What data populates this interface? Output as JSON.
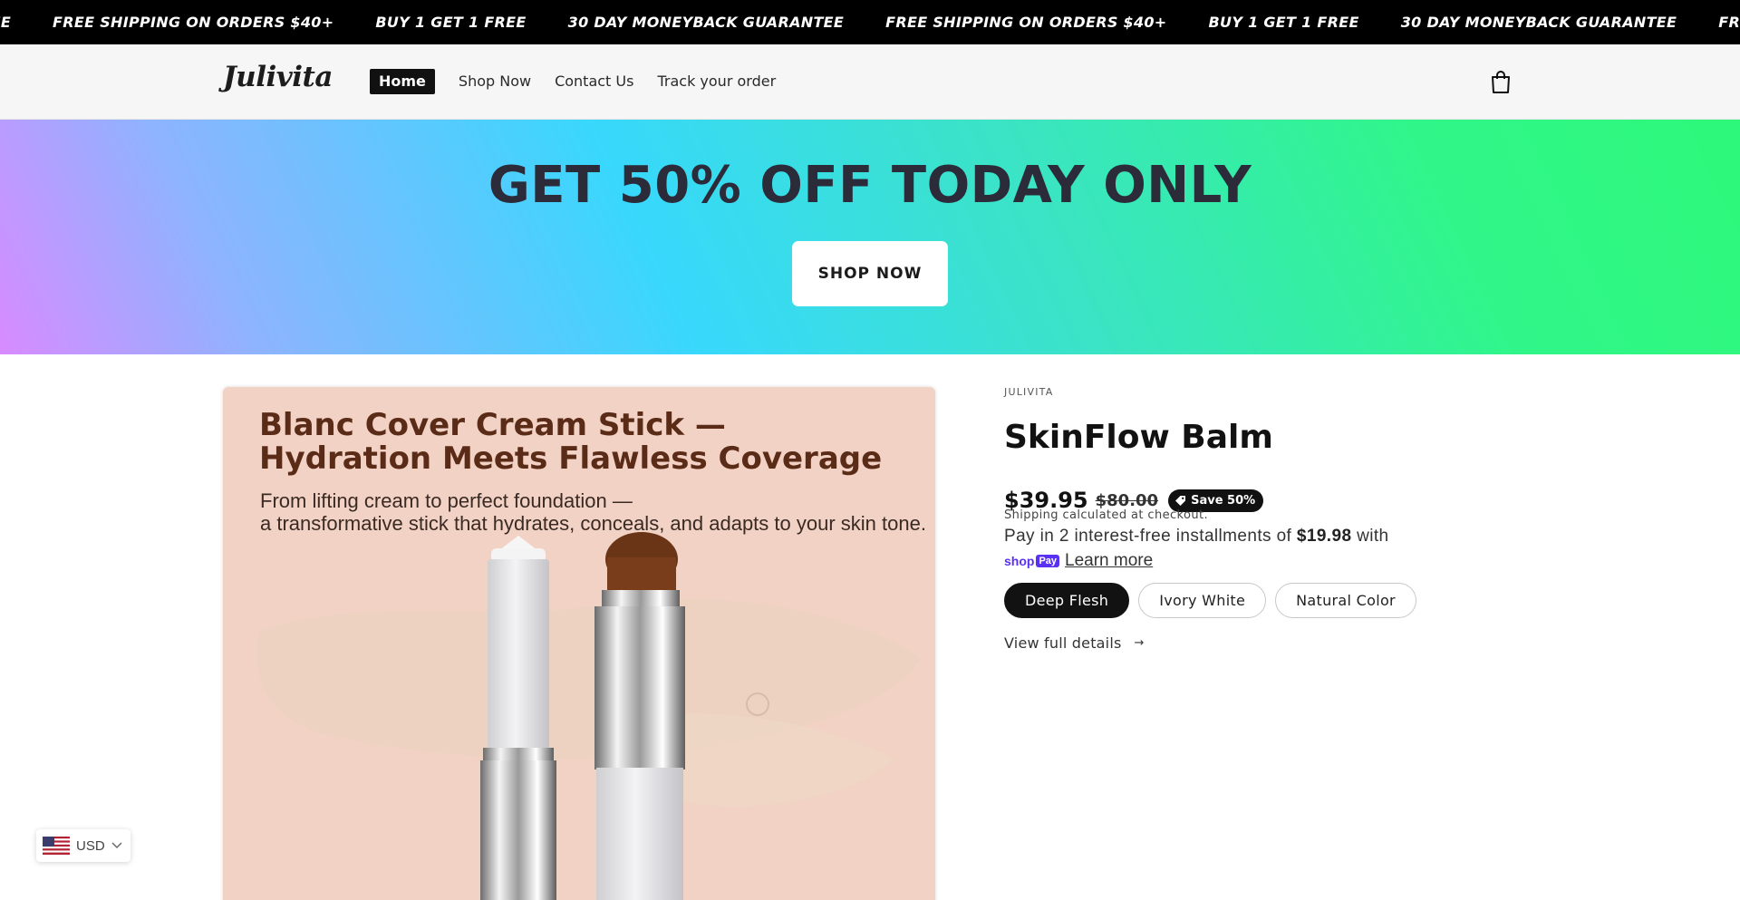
{
  "announcement": {
    "items": [
      "ANTEE",
      "FREE SHIPPING ON ORDERS $40+",
      "BUY 1 GET 1 FREE",
      "30 DAY MONEYBACK GUARANTEE",
      "FREE SHIPPING ON ORDERS $40+",
      "BUY 1 GET 1 FREE",
      "30 DAY MONEYBACK GUARANTEE",
      "FREE SHIPPIN"
    ]
  },
  "header": {
    "logo": "Julivita",
    "nav": [
      "Home",
      "Shop Now",
      "Contact Us",
      "Track your order"
    ],
    "active_nav": "Home",
    "cart_icon": "shopping-bag-icon"
  },
  "banner": {
    "title": "GET 50% OFF TODAY ONLY",
    "button": "SHOP NOW",
    "colors": [
      "#d88bff",
      "#38d8fc",
      "#2ef87a"
    ]
  },
  "media": {
    "headline_line1": "Blanc Cover Cream Stick —",
    "headline_line2": "Hydration Meets Flawless Coverage",
    "sub_line1": "From lifting cream to perfect foundation —",
    "sub_line2": "a transformative stick that hydrates, conceals, and adapts to your skin tone."
  },
  "product": {
    "vendor": "JULIVITA",
    "title": "SkinFlow Balm",
    "price": "$39.95",
    "compare_price": "$80.00",
    "save_badge": "Save 50%",
    "shipping_note": "Shipping calculated at checkout.",
    "installments_prefix": "Pay in 2 interest-free installments of ",
    "installments_amount": "$19.98",
    "installments_suffix": " with",
    "shoppay_label": "shop",
    "shoppay_pay": "Pay",
    "learn_more": "Learn more",
    "variants": [
      "Deep Flesh",
      "Ivory White",
      "Natural Color"
    ],
    "selected_variant": "Deep Flesh",
    "view_details": "View full details",
    "view_details_arrow": "→"
  },
  "currency": {
    "code": "USD",
    "flag_icon": "us-flag-icon"
  }
}
